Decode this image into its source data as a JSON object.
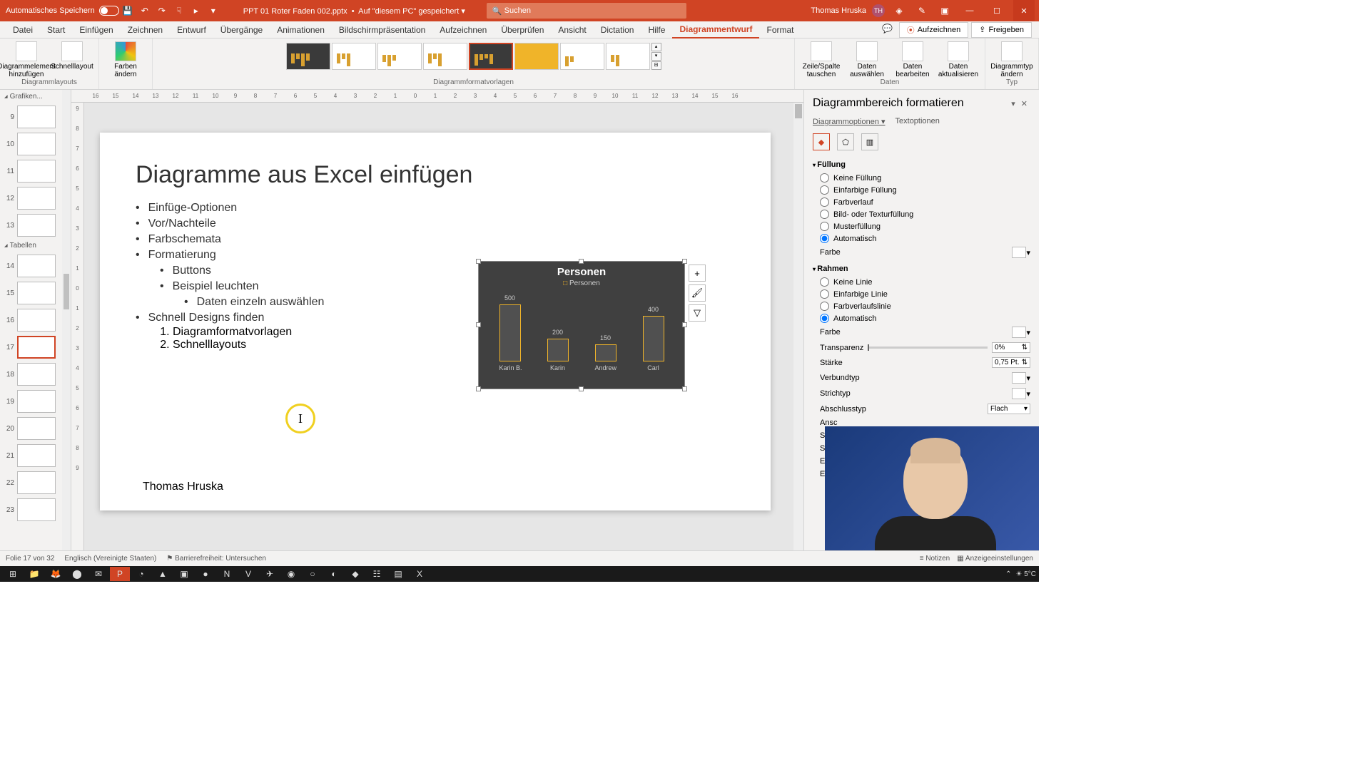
{
  "titlebar": {
    "autosave": "Automatisches Speichern",
    "filename": "PPT 01 Roter Faden 002.pptx",
    "saved": "Auf \"diesem PC\" gespeichert",
    "search_placeholder": "Suchen",
    "user": "Thomas Hruska",
    "initials": "TH"
  },
  "tabs": {
    "items": [
      "Datei",
      "Start",
      "Einfügen",
      "Zeichnen",
      "Entwurf",
      "Übergänge",
      "Animationen",
      "Bildschirmpräsentation",
      "Aufzeichnen",
      "Überprüfen",
      "Ansicht",
      "Dictation",
      "Hilfe",
      "Diagrammentwurf",
      "Format"
    ],
    "active": "Diagrammentwurf",
    "record": "Aufzeichnen",
    "share": "Freigeben"
  },
  "ribbon": {
    "g_layouts": "Diagrammlayouts",
    "add_element": "Diagrammelement hinzufügen",
    "quick_layout": "Schnelllayout",
    "colors": "Farben ändern",
    "g_styles": "Diagrammformatvorlagen",
    "g_data": "Daten",
    "switch": "Zeile/Spalte tauschen",
    "select": "Daten auswählen",
    "edit": "Daten bearbeiten",
    "refresh": "Daten aktualisieren",
    "g_type": "Typ",
    "changetype": "Diagrammtyp ändern"
  },
  "ruler": [
    "16",
    "15",
    "14",
    "13",
    "12",
    "11",
    "10",
    "9",
    "8",
    "7",
    "6",
    "5",
    "4",
    "3",
    "2",
    "1",
    "0",
    "1",
    "2",
    "3",
    "4",
    "5",
    "6",
    "7",
    "8",
    "9",
    "10",
    "11",
    "12",
    "13",
    "14",
    "15",
    "16"
  ],
  "thumbs": {
    "heads": [
      "Grafiken...",
      "Tabellen"
    ],
    "nums": [
      "9",
      "10",
      "11",
      "12",
      "13",
      "14",
      "15",
      "16",
      "17",
      "18",
      "19",
      "20",
      "21",
      "22",
      "23"
    ],
    "active": "17"
  },
  "slide": {
    "title": "Diagramme aus Excel einfügen",
    "b1": "Einfüge-Optionen",
    "b2": "Vor/Nachteile",
    "b3": "Farbschemata",
    "b4": "Formatierung",
    "b4a": "Buttons",
    "b4b": "Beispiel leuchten",
    "b4b1": "Daten einzeln auswählen",
    "b5": "Schnell Designs finden",
    "b5_1": "Diagramformatvorlagen",
    "b5_2": "Schnelllayouts",
    "author": "Thomas Hruska"
  },
  "chart_data": {
    "type": "bar",
    "title": "Personen",
    "legend": "Personen",
    "categories": [
      "Karin B.",
      "Karin",
      "Andrew",
      "Carl"
    ],
    "values": [
      500,
      200,
      150,
      400
    ],
    "ylim": [
      0,
      500
    ]
  },
  "pane": {
    "title": "Diagrammbereich formatieren",
    "tab1": "Diagrammoptionen",
    "tab2": "Textoptionen",
    "sec_fill": "Füllung",
    "fill_none": "Keine Füllung",
    "fill_solid": "Einfarbige Füllung",
    "fill_grad": "Farbverlauf",
    "fill_pic": "Bild- oder Texturfüllung",
    "fill_patt": "Musterfüllung",
    "fill_auto": "Automatisch",
    "color": "Farbe",
    "sec_border": "Rahmen",
    "line_none": "Keine Linie",
    "line_solid": "Einfarbige Linie",
    "line_grad": "Farbverlaufslinie",
    "line_auto": "Automatisch",
    "transp": "Transparenz",
    "transp_v": "0%",
    "width": "Stärke",
    "width_v": "0,75 Pt.",
    "compound": "Verbundtyp",
    "dash": "Strichtyp",
    "cap": "Abschlusstyp",
    "cap_v": "Flach",
    "join": "Ansc",
    "arrow1": "Startp",
    "arrow2": "Startp",
    "arrow3": "Endp",
    "arrow4": "Endp"
  },
  "status": {
    "slide": "Folie 17 von 32",
    "lang": "Englisch (Vereinigte Staaten)",
    "access": "Barrierefreiheit: Untersuchen",
    "notes": "Notizen",
    "display": "Anzeigeeinstellungen"
  },
  "task": {
    "temp": "5°C"
  }
}
